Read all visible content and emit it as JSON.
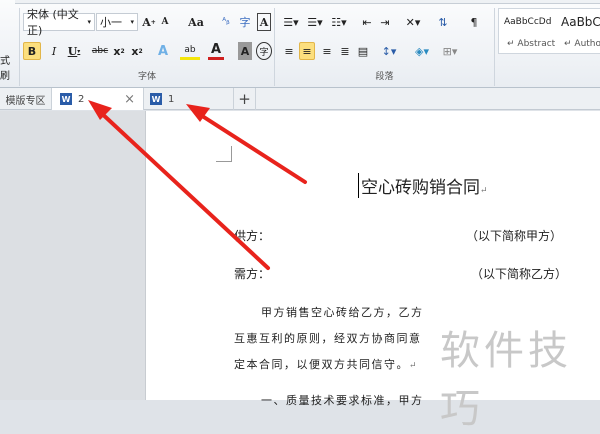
{
  "ribbon": {
    "left_cut_label": "式刷",
    "font": {
      "name": "宋体 (中文正)",
      "size": "小一",
      "group_label": "字体"
    },
    "paragraph": {
      "group_label": "段落"
    },
    "styles": [
      {
        "preview": "AaBbCcDd",
        "name": "Abstract"
      },
      {
        "preview": "AaBbC",
        "name": "Autho"
      }
    ]
  },
  "tabs": {
    "template": "模版专区",
    "docs": [
      {
        "label": "2"
      },
      {
        "label": "1"
      }
    ],
    "add": "+",
    "close": "×"
  },
  "document": {
    "title": "空心砖购销合同",
    "supplier_label": "供方：",
    "supplier_note": "（以下简称甲方）",
    "buyer_label": "需方：",
    "buyer_note": "（以下简称乙方）",
    "para1": "甲方销售空心砖给乙方，乙方",
    "para2": "互惠互利的原则，经双方协商同意",
    "para3": "定本合同，以便双方共同信守。",
    "para4": "一、质量技术要求标准，甲方",
    "para_mark": "↵"
  },
  "watermark": "软件技巧",
  "colors": {
    "arrow": "#e8231c",
    "highlight": "#fcdf7e"
  }
}
